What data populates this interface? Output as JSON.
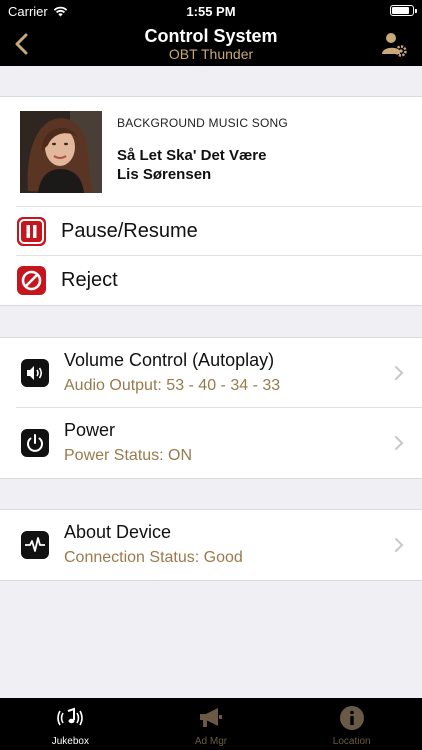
{
  "status_bar": {
    "carrier": "Carrier",
    "time": "1:55 PM",
    "battery_level": 0.85
  },
  "nav": {
    "title": "Control System",
    "subtitle": "OBT Thunder"
  },
  "now_playing": {
    "kicker": "BACKGROUND MUSIC SONG",
    "song_title": "Så Let Ska' Det Være",
    "artist": "Lis Sørensen"
  },
  "actions": {
    "pause_label": "Pause/Resume",
    "reject_label": "Reject"
  },
  "settings": {
    "volume_title": "Volume Control (Autoplay)",
    "volume_sub": "Audio Output: 53 - 40 - 34 - 33",
    "power_title": "Power",
    "power_sub": "Power Status: ON"
  },
  "device": {
    "about_title": "About Device",
    "about_sub": "Connection Status: Good"
  },
  "tabs": [
    {
      "label": "Jukebox"
    },
    {
      "label": "Ad Mgr"
    },
    {
      "label": "Location"
    }
  ],
  "colors": {
    "accent": "#c8a977",
    "secondary_text": "#9a7a4d",
    "action_red": "#c4161c"
  }
}
